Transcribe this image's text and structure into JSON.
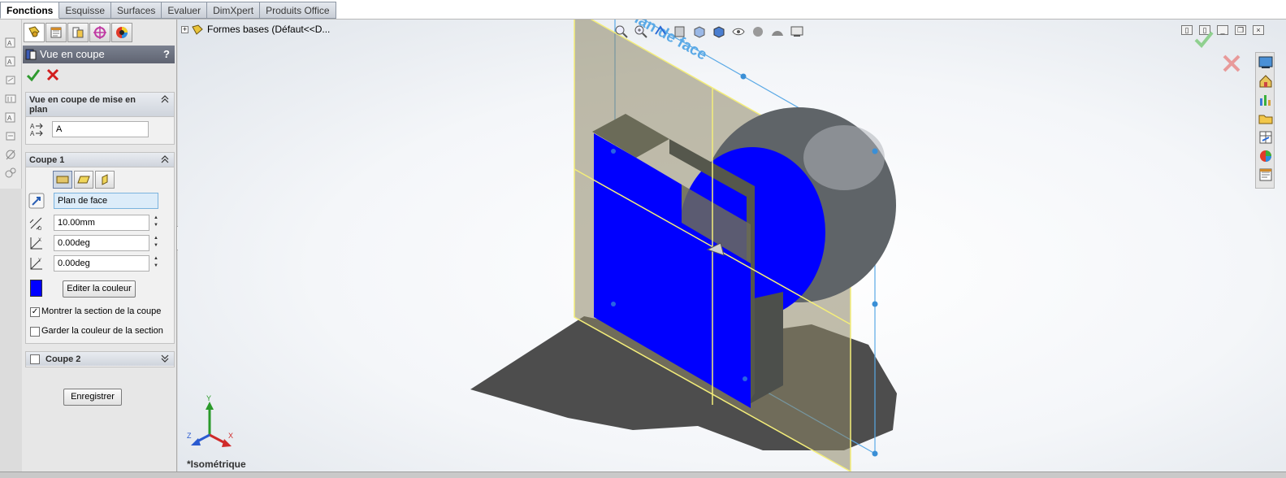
{
  "tabs": [
    {
      "label": "Fonctions",
      "active": true
    },
    {
      "label": "Esquisse",
      "active": false
    },
    {
      "label": "Surfaces",
      "active": false
    },
    {
      "label": "Evaluer",
      "active": false
    },
    {
      "label": "DimXpert",
      "active": false
    },
    {
      "label": "Produits Office",
      "active": false
    }
  ],
  "panel": {
    "title": "Vue en coupe",
    "help": "?",
    "group_plan": {
      "title": "Vue en coupe de mise en plan",
      "label_value": "A"
    },
    "group_cut1": {
      "title": "Coupe 1",
      "reference": "Plan de face",
      "distance": "10.00mm",
      "angle_x": "0.00deg",
      "angle_y": "0.00deg",
      "edit_color_label": "Editer la couleur",
      "show_section_label": "Montrer la section de la coupe",
      "show_section_checked": true,
      "keep_color_label": "Garder la couleur de la section",
      "keep_color_checked": false,
      "section_color": "#0000ff"
    },
    "group_cut2": {
      "title": "Coupe 2",
      "checked": false
    },
    "save_label": "Enregistrer"
  },
  "viewport": {
    "tree_node": "Formes bases  (Défaut<<D...",
    "view_name": "*Isométrique",
    "plane_label": "Plan de face",
    "axis_x": "X",
    "axis_y": "Y",
    "axis_z": "Z"
  },
  "colors": {
    "section": "#0000ff",
    "plane_edge": "#f4ee7a",
    "sketch_blue": "#5aa9e6",
    "accept": "#3aa83a",
    "reject": "#d42020"
  }
}
